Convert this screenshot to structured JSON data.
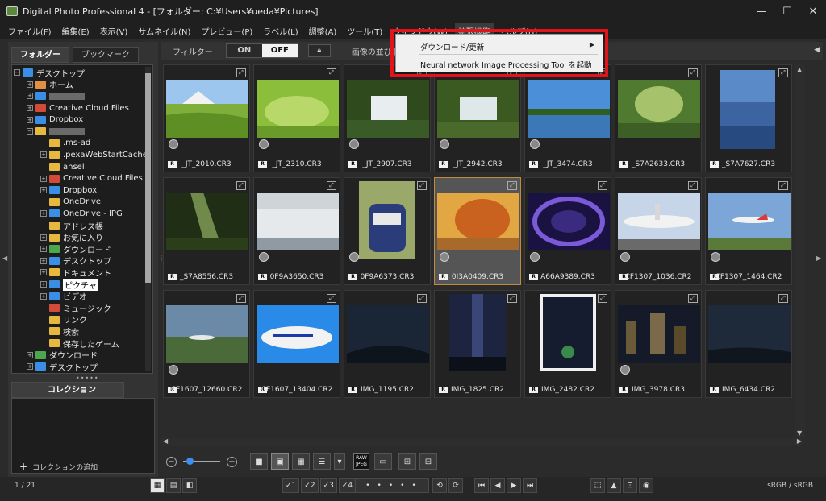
{
  "window": {
    "title": "Digital Photo Professional 4 - [フォルダー: C:¥Users¥ueda¥Pictures]",
    "controls": [
      "—",
      "☐",
      "✕"
    ]
  },
  "menubar": [
    "ファイル(F)",
    "編集(E)",
    "表示(V)",
    "サムネイル(N)",
    "プレビュー(P)",
    "ラベル(L)",
    "調整(A)",
    "ツール(T)",
    "ウィンドウ(W)",
    "拡張機能",
    "ヘルプ(H)"
  ],
  "dropdown": {
    "items": [
      "ダウンロード/更新",
      "Neural network Image Processing Tool を起動"
    ],
    "highlight_color": "#e0141a"
  },
  "left_panel": {
    "tabs": [
      "フォルダー",
      "ブックマーク"
    ],
    "tree": [
      "デスクトップ",
      "ホーム",
      "",
      "Creative Cloud Files",
      "Dropbox",
      "",
      ".ms-ad",
      ".pexaWebStartCache",
      "ansel",
      "Creative Cloud Files",
      "Dropbox",
      "OneDrive",
      "OneDrive - IPG",
      "アドレス帳",
      "お気に入り",
      "ダウンロード",
      "デスクトップ",
      "ドキュメント",
      "ピクチャ",
      "ビデオ",
      "ミュージック",
      "リンク",
      "検索",
      "保存したゲーム",
      "ダウンロード",
      "デスクトップ"
    ],
    "collection_tab": "コレクション",
    "collection_add": "コレクションの追加"
  },
  "toolbar": {
    "filter_label": "フィルター",
    "on": "ON",
    "off": "OFF",
    "sort_label": "画像の並び順"
  },
  "thumbnails": [
    {
      "name": "_JT_2010.CR3"
    },
    {
      "name": "_JT_2310.CR3"
    },
    {
      "name": "_JT_2907.CR3"
    },
    {
      "name": "_JT_2942.CR3"
    },
    {
      "name": "_JT_3474.CR3"
    },
    {
      "name": "_S7A2633.CR3"
    },
    {
      "name": "_S7A7627.CR3"
    },
    {
      "name": "_S7A8556.CR3"
    },
    {
      "name": "0F9A3650.CR3"
    },
    {
      "name": "0F9A6373.CR3"
    },
    {
      "name": "0I3A0409.CR3",
      "selected": true
    },
    {
      "name": "A66A9389.CR3"
    },
    {
      "name": "CF1307_1036.CR2"
    },
    {
      "name": "CF1307_1464.CR2"
    },
    {
      "name": "CF1607_12660.CR2"
    },
    {
      "name": "CF1607_13404.CR2"
    },
    {
      "name": "IMG_1195.CR2"
    },
    {
      "name": "IMG_1825.CR2"
    },
    {
      "name": "IMG_2482.CR2"
    },
    {
      "name": "IMG_3978.CR3"
    },
    {
      "name": "IMG_6434.CR2"
    }
  ],
  "viewbar": {
    "raw_label": "RAW JPEG"
  },
  "statusbar": {
    "count": "1 / 21",
    "rating_buttons": [
      "✓1",
      "✓2",
      "✓3",
      "✓4",
      "✓5"
    ],
    "dots": "•••••",
    "color_space": "sRGB / sRGB"
  }
}
